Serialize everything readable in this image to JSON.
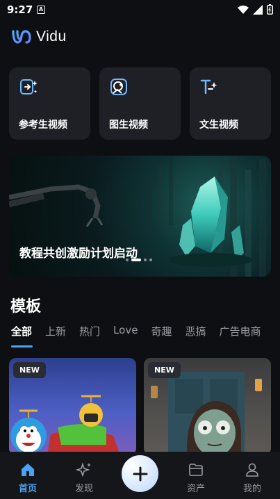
{
  "status_bar": {
    "time": "9:27",
    "notification_letter": "A"
  },
  "app": {
    "name": "Vidu"
  },
  "tools": [
    {
      "label": "参考生视频",
      "icon": "reference-video-icon"
    },
    {
      "label": "图生视频",
      "icon": "image-video-icon"
    },
    {
      "label": "文生视频",
      "icon": "text-video-icon"
    }
  ],
  "banner": {
    "title": "教程共创激励计划启动",
    "slides": 4,
    "active_slide": 1
  },
  "templates": {
    "title": "模板",
    "tabs": [
      "全部",
      "上新",
      "热门",
      "Love",
      "奇趣",
      "恶搞",
      "广告电商"
    ],
    "active_tab": 0,
    "cards": [
      {
        "badge": "NEW"
      },
      {
        "badge": "NEW"
      }
    ]
  },
  "nav": {
    "items": [
      {
        "label": "首页",
        "icon": "home-icon"
      },
      {
        "label": "发现",
        "icon": "sparkle-icon"
      },
      {
        "label": "资产",
        "icon": "folder-icon"
      },
      {
        "label": "我的",
        "icon": "user-icon"
      }
    ],
    "active": 0
  },
  "colors": {
    "accent": "#4aa3f5",
    "background": "#0e0f12",
    "card": "#1f2026"
  }
}
